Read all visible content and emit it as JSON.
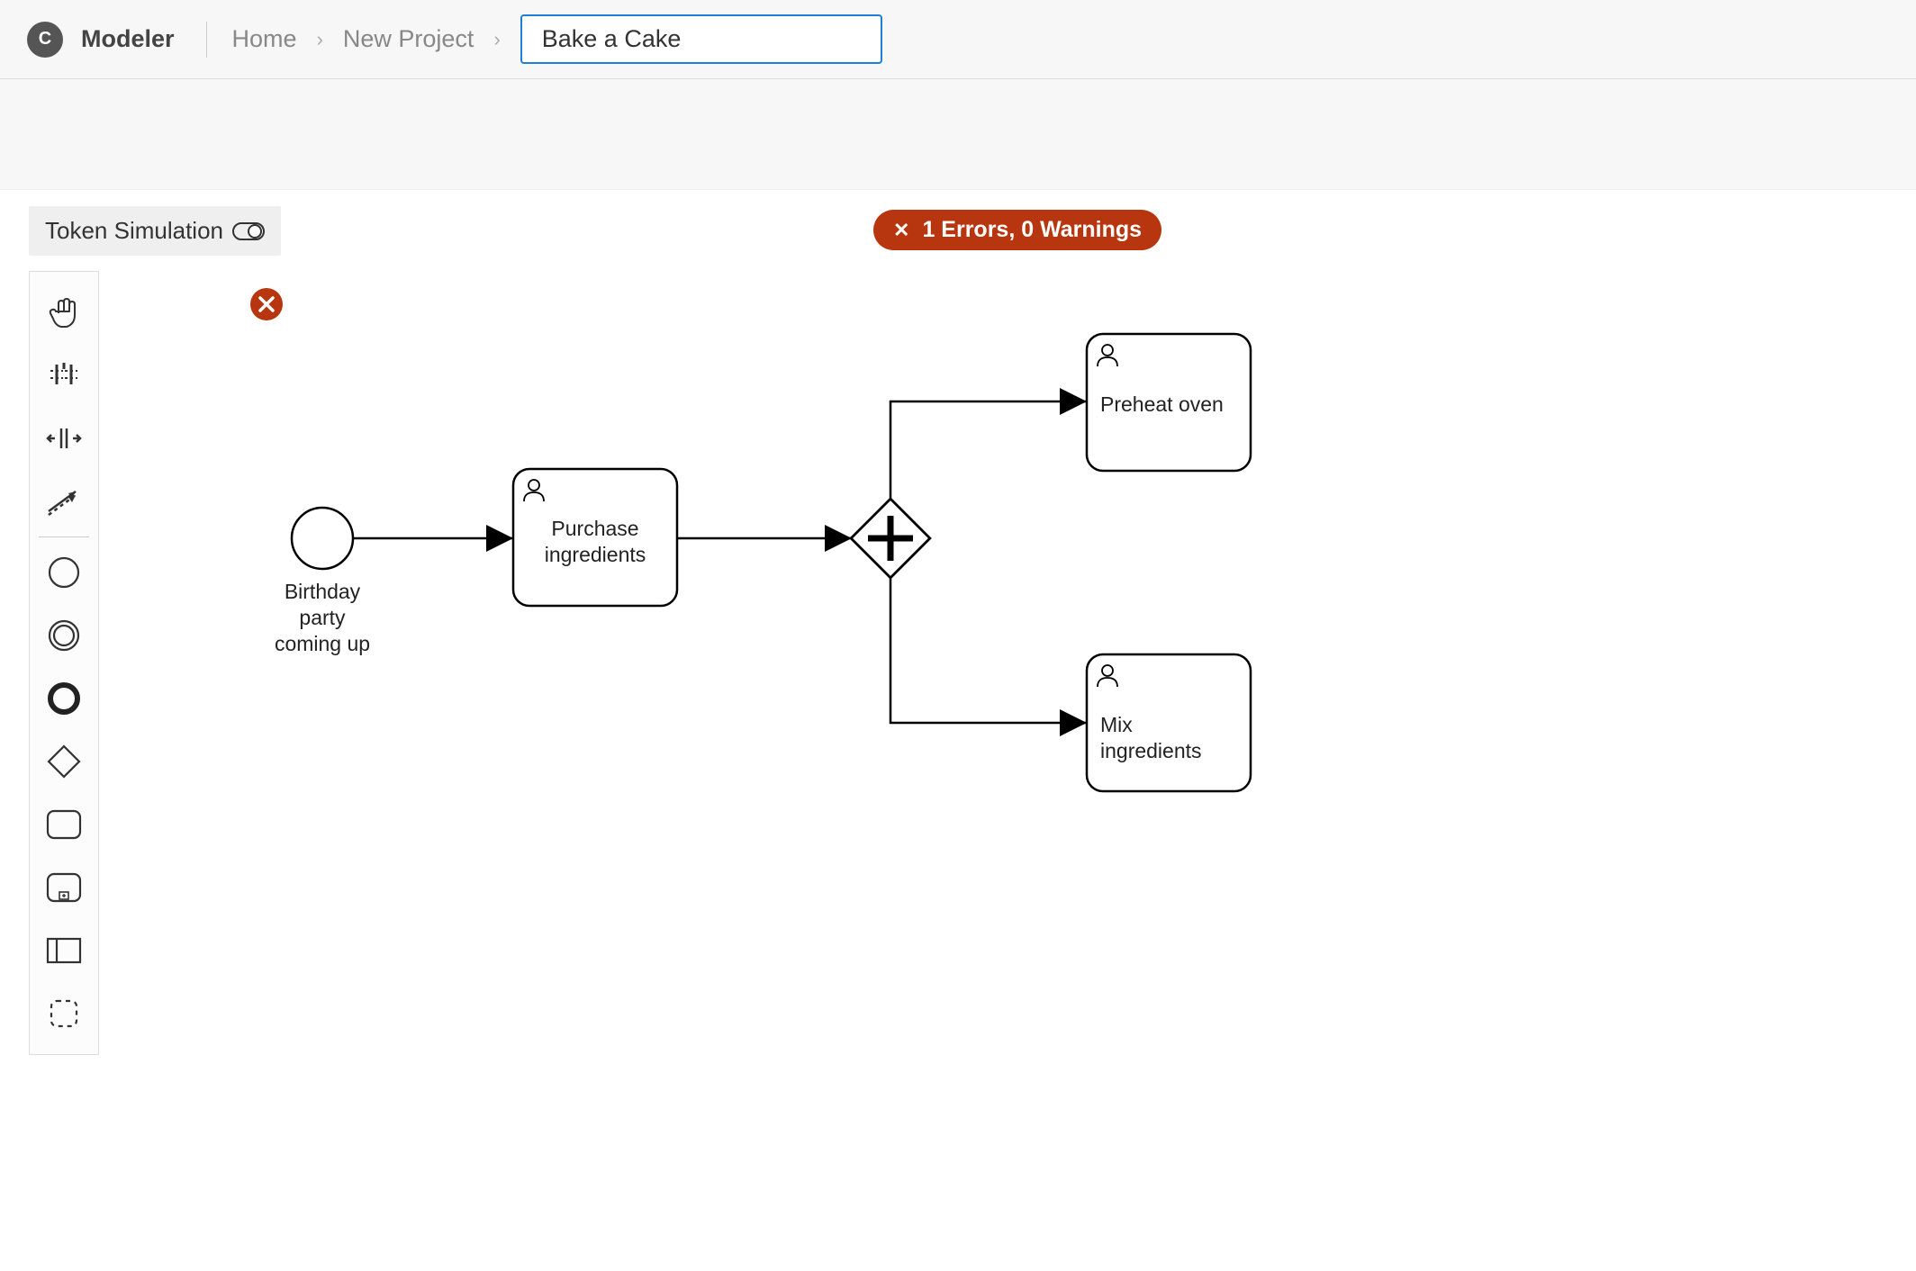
{
  "app": {
    "logo_letter": "C",
    "title": "Modeler"
  },
  "breadcrumbs": {
    "home": "Home",
    "project": "New Project",
    "current": "Bake a Cake"
  },
  "token_sim_label": "Token Simulation",
  "errors": {
    "text": "1 Errors, 0 Warnings"
  },
  "palette_tools": [
    {
      "name": "hand-tool",
      "icon": "hand"
    },
    {
      "name": "lasso-tool",
      "icon": "lasso"
    },
    {
      "name": "space-tool",
      "icon": "space"
    },
    {
      "name": "global-connect-tool",
      "icon": "connect"
    }
  ],
  "palette_shapes": [
    {
      "name": "create-start-event",
      "icon": "thin-circle"
    },
    {
      "name": "create-intermediate-event",
      "icon": "double-circle"
    },
    {
      "name": "create-end-event",
      "icon": "thick-circle"
    },
    {
      "name": "create-gateway",
      "icon": "diamond"
    },
    {
      "name": "create-task",
      "icon": "rounded-rect"
    },
    {
      "name": "create-subprocess",
      "icon": "expanded-subprocess"
    },
    {
      "name": "create-data-object",
      "icon": "data-rect"
    },
    {
      "name": "create-group",
      "icon": "dashed-rect"
    }
  ],
  "diagram": {
    "start_event": {
      "label": "Birthday party\ncoming up"
    },
    "task1": {
      "label": "Purchase ingredients"
    },
    "task2": {
      "label": "Preheat oven"
    },
    "task3": {
      "label": "Mix ingredients"
    },
    "error_marker": {
      "present": true
    }
  }
}
